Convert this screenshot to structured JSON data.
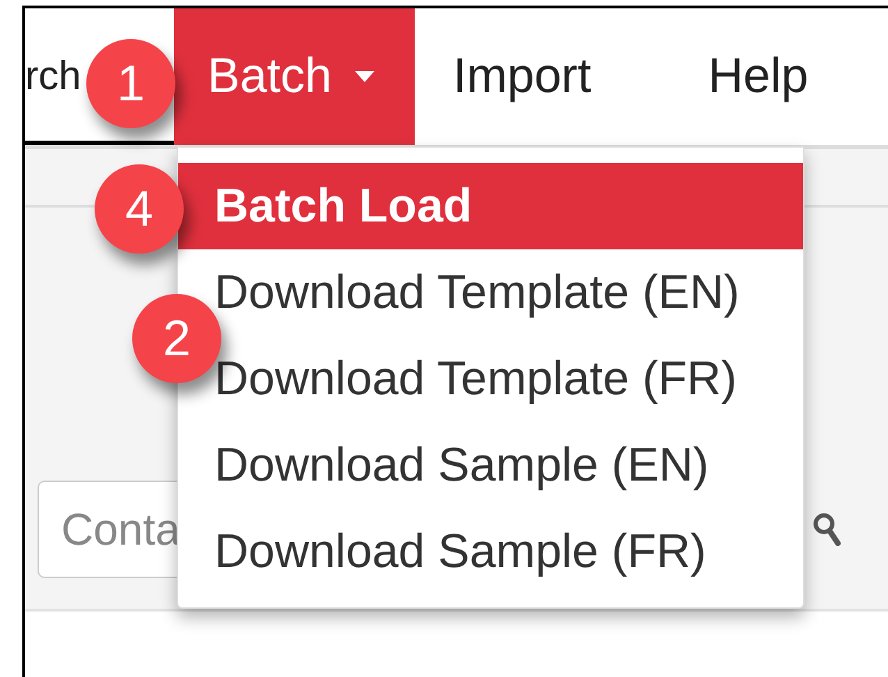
{
  "nav": {
    "items": [
      {
        "label": "rch",
        "selected": false,
        "caret": false
      },
      {
        "label": "Batch",
        "selected": true,
        "caret": true
      },
      {
        "label": "Import",
        "selected": false,
        "caret": false
      },
      {
        "label": "Help",
        "selected": false,
        "caret": false
      }
    ]
  },
  "dropdown": {
    "items": [
      {
        "label": "Batch Load",
        "selected": true
      },
      {
        "label": "Download Template (EN)",
        "selected": false
      },
      {
        "label": "Download Template (FR)",
        "selected": false
      },
      {
        "label": "Download Sample (EN)",
        "selected": false
      },
      {
        "label": "Download Sample (FR)",
        "selected": false
      }
    ]
  },
  "search": {
    "placeholder": "Conta"
  },
  "callouts": [
    {
      "number": "1"
    },
    {
      "number": "4"
    },
    {
      "number": "2"
    }
  ]
}
